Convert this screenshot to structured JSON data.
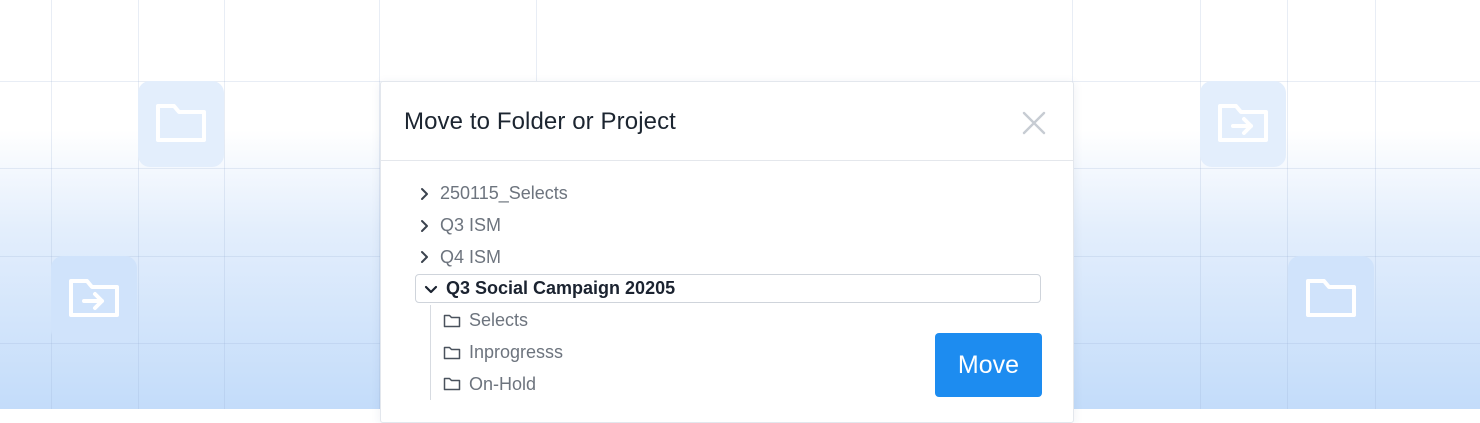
{
  "dialog": {
    "title": "Move to Folder or Project",
    "close_icon": "close-icon",
    "move_label": "Move"
  },
  "tree": {
    "items": [
      {
        "label": "250115_Selects",
        "expanded": false,
        "icon": "chevron-right-icon"
      },
      {
        "label": "Q3 ISM",
        "expanded": false,
        "icon": "chevron-right-icon"
      },
      {
        "label": "Q4 ISM",
        "expanded": false,
        "icon": "chevron-right-icon"
      },
      {
        "label": "Q3 Social Campaign 20205",
        "expanded": true,
        "selected": true,
        "icon": "chevron-down-icon"
      }
    ],
    "children": [
      {
        "label": "Selects",
        "icon": "folder-icon"
      },
      {
        "label": "Inprogresss",
        "icon": "folder-icon"
      },
      {
        "label": "On-Hold",
        "icon": "folder-icon"
      }
    ]
  },
  "colors": {
    "accent": "#1d8cf0",
    "background_top": "#ffffff",
    "background_bottom": "#c3dcfa",
    "tile": "#d0e3fb"
  },
  "decor": {
    "tiles": [
      "folder-icon",
      "folder-move-icon",
      "folder-move-icon",
      "folder-icon"
    ]
  }
}
